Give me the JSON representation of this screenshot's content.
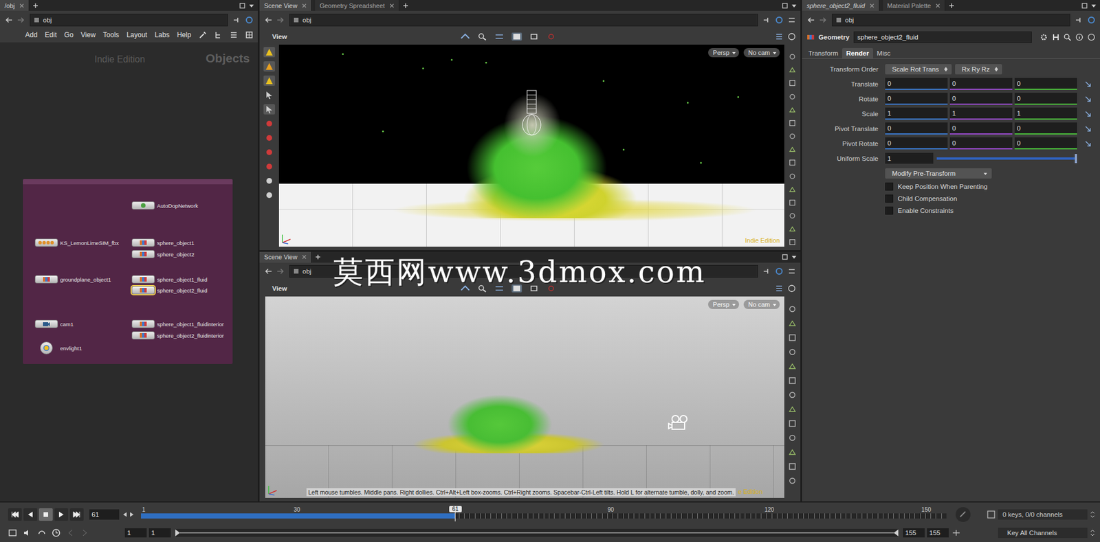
{
  "network_pane": {
    "tab": {
      "label": "/obj",
      "selected": true
    },
    "path": "obj",
    "menu": [
      "Add",
      "Edit",
      "Go",
      "View",
      "Tools",
      "Layout",
      "Labs",
      "Help"
    ],
    "edition": "Indie Edition",
    "context": "Objects",
    "nodes": [
      {
        "name": "AutoDopNetwork",
        "kind": "dop",
        "selected": false
      },
      {
        "name": "KS_LemonLimeSIM_fbx",
        "kind": "fbx",
        "selected": false
      },
      {
        "name": "sphere_object1",
        "kind": "geo",
        "selected": false
      },
      {
        "name": "sphere_object2",
        "kind": "geo",
        "selected": false
      },
      {
        "name": "groundplane_object1",
        "kind": "geo",
        "selected": false
      },
      {
        "name": "sphere_object1_fluid",
        "kind": "geo",
        "selected": false
      },
      {
        "name": "sphere_object2_fluid",
        "kind": "geo",
        "selected": true
      },
      {
        "name": "cam1",
        "kind": "camera",
        "selected": false
      },
      {
        "name": "sphere_object1_fluidinterior",
        "kind": "geo",
        "selected": false
      },
      {
        "name": "sphere_object2_fluidinterior",
        "kind": "geo",
        "selected": false
      },
      {
        "name": "envlight1",
        "kind": "light",
        "selected": false
      }
    ]
  },
  "viewer_top": {
    "tabs": [
      {
        "label": "Scene View",
        "selected": true
      },
      {
        "label": "Geometry Spreadsheet",
        "selected": false
      }
    ],
    "path": "obj",
    "view_label": "View",
    "camera_menus": [
      "Persp",
      "No cam"
    ],
    "edition": "Indie Edition"
  },
  "viewer_bottom": {
    "tabs": [
      {
        "label": "Scene View",
        "selected": true
      }
    ],
    "path": "obj",
    "view_label": "View",
    "camera_menus": [
      "Persp",
      "No cam"
    ],
    "hint": "Left mouse tumbles. Middle pans. Right dollies. Ctrl+Alt+Left box-zooms. Ctrl+Right zooms. Spacebar-Ctrl-Left tilts. Hold L for alternate tumble, dolly, and zoom.",
    "edition": "e Edition"
  },
  "parameters": {
    "tabs": [
      {
        "label": "sphere_object2_fluid",
        "selected": true
      },
      {
        "label": "Material Palette",
        "selected": false
      }
    ],
    "path": "obj",
    "node_type": "Geometry",
    "node_name": "sphere_object2_fluid",
    "param_tabs": [
      {
        "label": "Transform",
        "selected": false
      },
      {
        "label": "Render",
        "selected": true
      },
      {
        "label": "Misc",
        "selected": false
      }
    ],
    "transform_order": {
      "label": "Transform Order",
      "values": [
        "Scale Rot Trans",
        "Rx Ry Rz"
      ]
    },
    "vectors": [
      {
        "label": "Translate",
        "values": [
          "0",
          "0",
          "0"
        ]
      },
      {
        "label": "Rotate",
        "values": [
          "0",
          "0",
          "0"
        ]
      },
      {
        "label": "Scale",
        "values": [
          "1",
          "1",
          "1"
        ]
      },
      {
        "label": "Pivot Translate",
        "values": [
          "0",
          "0",
          "0"
        ]
      },
      {
        "label": "Pivot Rotate",
        "values": [
          "0",
          "0",
          "0"
        ]
      }
    ],
    "uniform_scale": {
      "label": "Uniform Scale",
      "value": "1",
      "level": 1
    },
    "pre_transform": "Modify Pre-Transform",
    "checkboxes": [
      {
        "label": "Keep Position When Parenting",
        "checked": false
      },
      {
        "label": "Child Compensation",
        "checked": false
      },
      {
        "label": "Enable Constraints",
        "checked": false
      }
    ]
  },
  "timeline": {
    "transport": [
      {
        "kind": "first",
        "selected": false
      },
      {
        "kind": "back",
        "selected": false
      },
      {
        "kind": "stop",
        "selected": true
      },
      {
        "kind": "play",
        "selected": false
      },
      {
        "kind": "last",
        "selected": false
      }
    ],
    "frame": "61",
    "current": "61",
    "ticks": [
      "1",
      "30",
      "90",
      "120",
      "150"
    ],
    "level": 0.39,
    "range_start": "1",
    "range_start2": "1",
    "range_end": "155",
    "range_end2": "155",
    "keys": "0 keys, 0/0 channels",
    "key_button": "Key All Channels"
  },
  "watermark": "莫西网www.3dmox.com"
}
